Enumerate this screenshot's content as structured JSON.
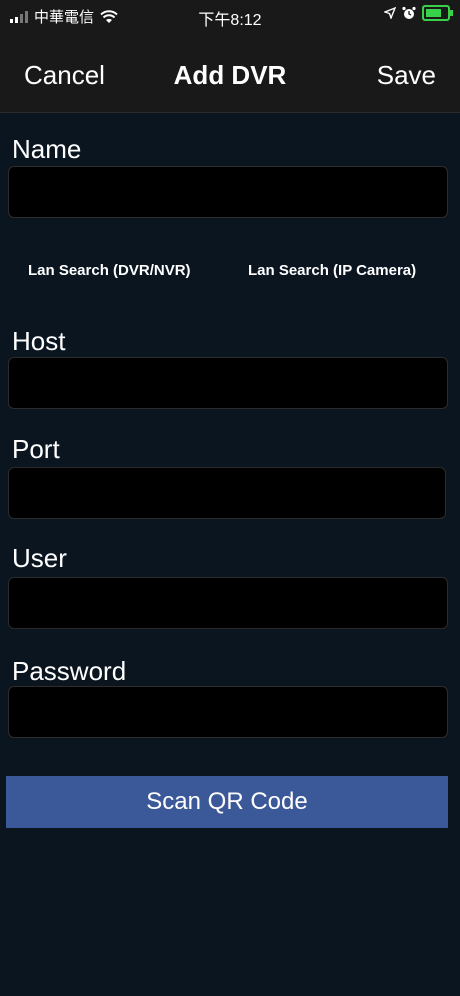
{
  "status_bar": {
    "carrier": "中華電信",
    "time": "下午8:12",
    "icons": [
      "signal-bars-icon",
      "wifi-icon",
      "location-arrow-icon",
      "alarm-icon",
      "battery-charging-icon"
    ],
    "battery_color": "#3ad14a"
  },
  "nav": {
    "cancel_label": "Cancel",
    "title": "Add DVR",
    "save_label": "Save"
  },
  "form": {
    "name_label": "Name",
    "name_value": "",
    "lan_search_dvr_label": "Lan Search (DVR/NVR)",
    "lan_search_ip_label": "Lan Search (IP Camera)",
    "host_label": "Host",
    "host_value": "",
    "port_label": "Port",
    "port_value": "",
    "user_label": "User",
    "user_value": "",
    "password_label": "Password",
    "password_value": ""
  },
  "scan_button": {
    "label": "Scan QR Code",
    "color": "#3b5998"
  }
}
